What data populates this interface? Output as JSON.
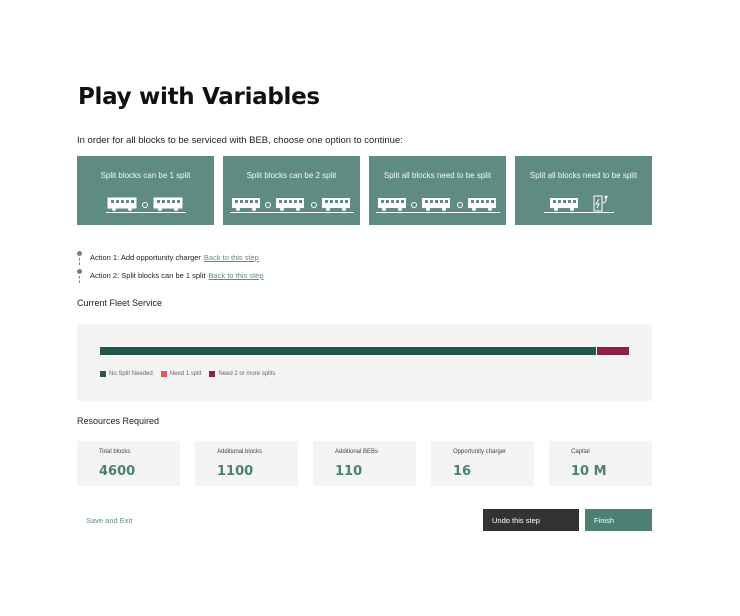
{
  "page": {
    "title": "Play with Variables"
  },
  "instructions": "In order for all blocks to be serviced with BEB, choose one option to continue:",
  "options": [
    {
      "label": "Split blocks can be 1 split",
      "icon": "two-buses-charge-icon"
    },
    {
      "label": "Split blocks can be 2 split",
      "icon": "three-buses-charge-icon"
    },
    {
      "label": "Split all blocks need to be split",
      "icon": "three-buses-charge-icon"
    },
    {
      "label": "Split all blocks need to be split",
      "icon": "bus-charger-icon"
    }
  ],
  "actions": [
    {
      "text": "Action 1: Add opportunity charger",
      "link": "Back to this step"
    },
    {
      "text": "Action 2: Split blocks can be 1 split",
      "link": "Back to this step"
    }
  ],
  "fleet": {
    "title": "Current Fleet Service",
    "segments": [
      {
        "name": "No Split Needed",
        "fraction": 0.94,
        "color": "#235851"
      },
      {
        "name": "Need 1 split",
        "fraction": 0.0,
        "color": "#e05a5a"
      },
      {
        "name": "Need 2 or more splits",
        "fraction": 0.06,
        "color": "#8b2148"
      }
    ]
  },
  "resources": {
    "title": "Resources Required",
    "cards": [
      {
        "label": "Total blocks",
        "value": "4600"
      },
      {
        "label": "Additional blocks",
        "value": "1100"
      },
      {
        "label": "Additional BEBs",
        "value": "110"
      },
      {
        "label": "Opportunity charger",
        "value": "16"
      },
      {
        "label": "Capital",
        "value": "10 M"
      }
    ]
  },
  "footer": {
    "save_exit": "Save and Exit",
    "undo": "Undo this step",
    "finish": "Finish"
  }
}
